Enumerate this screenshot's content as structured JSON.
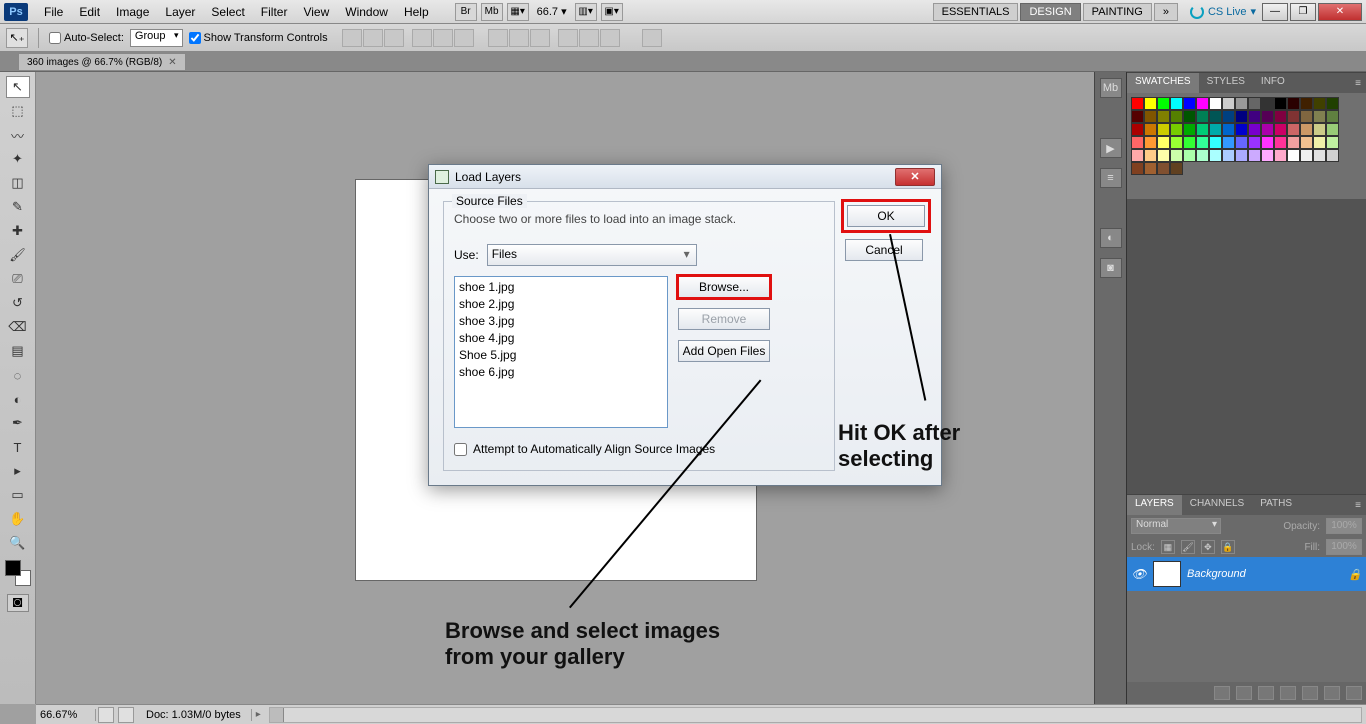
{
  "menu": {
    "items": [
      "File",
      "Edit",
      "Image",
      "Layer",
      "Select",
      "Filter",
      "View",
      "Window",
      "Help"
    ],
    "zoom": "66.7"
  },
  "workspaces": {
    "items": [
      "ESSENTIALS",
      "DESIGN",
      "PAINTING"
    ],
    "active": 1,
    "cslive": "CS Live"
  },
  "options": {
    "autoSelect": "Auto-Select:",
    "autoSelectVal": "Group",
    "showTransform": "Show Transform Controls"
  },
  "docTab": "360 images @ 66.7% (RGB/8)",
  "status": {
    "zoom": "66.67%",
    "doc": "Doc: 1.03M/0 bytes"
  },
  "panels": {
    "swatches": {
      "tabs": [
        "SWATCHES",
        "STYLES",
        "INFO"
      ]
    },
    "layers": {
      "tabs": [
        "LAYERS",
        "CHANNELS",
        "PATHS"
      ],
      "mode": "Normal",
      "opacityLbl": "Opacity:",
      "opacity": "100%",
      "lockLbl": "Lock:",
      "fillLbl": "Fill:",
      "fill": "100%",
      "bgName": "Background"
    }
  },
  "dialog": {
    "title": "Load Layers",
    "sourceLegend": "Source Files",
    "hint": "Choose two or more files to load into an image stack.",
    "useLbl": "Use:",
    "useVal": "Files",
    "files": [
      "shoe 1.jpg",
      "shoe 2.jpg",
      "shoe 3.jpg",
      "shoe 4.jpg",
      "Shoe 5.jpg",
      "shoe 6.jpg"
    ],
    "browse": "Browse...",
    "remove": "Remove",
    "addOpen": "Add Open Files",
    "autoAlign": "Attempt to Automatically Align Source Images",
    "ok": "OK",
    "cancel": "Cancel"
  },
  "annotations": {
    "a1l1": "Hit OK after",
    "a1l2": "selecting",
    "a2l1": "Browse and select images",
    "a2l2": "from your gallery"
  },
  "tools": [
    "↖",
    "⬚",
    "◫",
    "✂",
    "✎",
    "✐",
    "⌫",
    "🖌",
    "⟆",
    "⎚",
    "△",
    "◌",
    "✒",
    "T",
    "▸",
    "✥",
    "🔍",
    "✋"
  ],
  "swatchColors": [
    "#ff0000",
    "#ffff00",
    "#00ff00",
    "#00ffff",
    "#0000ff",
    "#ff00ff",
    "#ffffff",
    "#cccccc",
    "#999999",
    "#666666",
    "#333333",
    "#000000",
    "#2a0000",
    "#402000",
    "#404000",
    "#204000",
    "#550000",
    "#805500",
    "#808000",
    "#558000",
    "#005500",
    "#008055",
    "#005555",
    "#004080",
    "#000080",
    "#400080",
    "#550055",
    "#800040",
    "#803333",
    "#806640",
    "#808050",
    "#608040",
    "#aa0000",
    "#cc7700",
    "#cccc00",
    "#77cc00",
    "#00aa00",
    "#00cc77",
    "#00aaaa",
    "#0066cc",
    "#0000cc",
    "#7700cc",
    "#aa00aa",
    "#cc0066",
    "#cc6666",
    "#cc9966",
    "#cccc88",
    "#99cc77",
    "#ff6666",
    "#ff9933",
    "#ffff66",
    "#99ff33",
    "#33ff33",
    "#33ff99",
    "#33ffff",
    "#3399ff",
    "#6666ff",
    "#9933ff",
    "#ff33ff",
    "#ff3399",
    "#f0a0a0",
    "#f0c090",
    "#f0f0a8",
    "#c0f0a0",
    "#ffaaaa",
    "#ffcc88",
    "#ffffaa",
    "#ccffaa",
    "#aaffaa",
    "#aaffcc",
    "#aaffff",
    "#aaccff",
    "#aaaaff",
    "#ccaaff",
    "#ffaaff",
    "#ffaacc",
    "#ffffff",
    "#f0f0f0",
    "#e0e0e0",
    "#d0d0d0",
    "#804020",
    "#a06030",
    "#805030",
    "#604020"
  ]
}
